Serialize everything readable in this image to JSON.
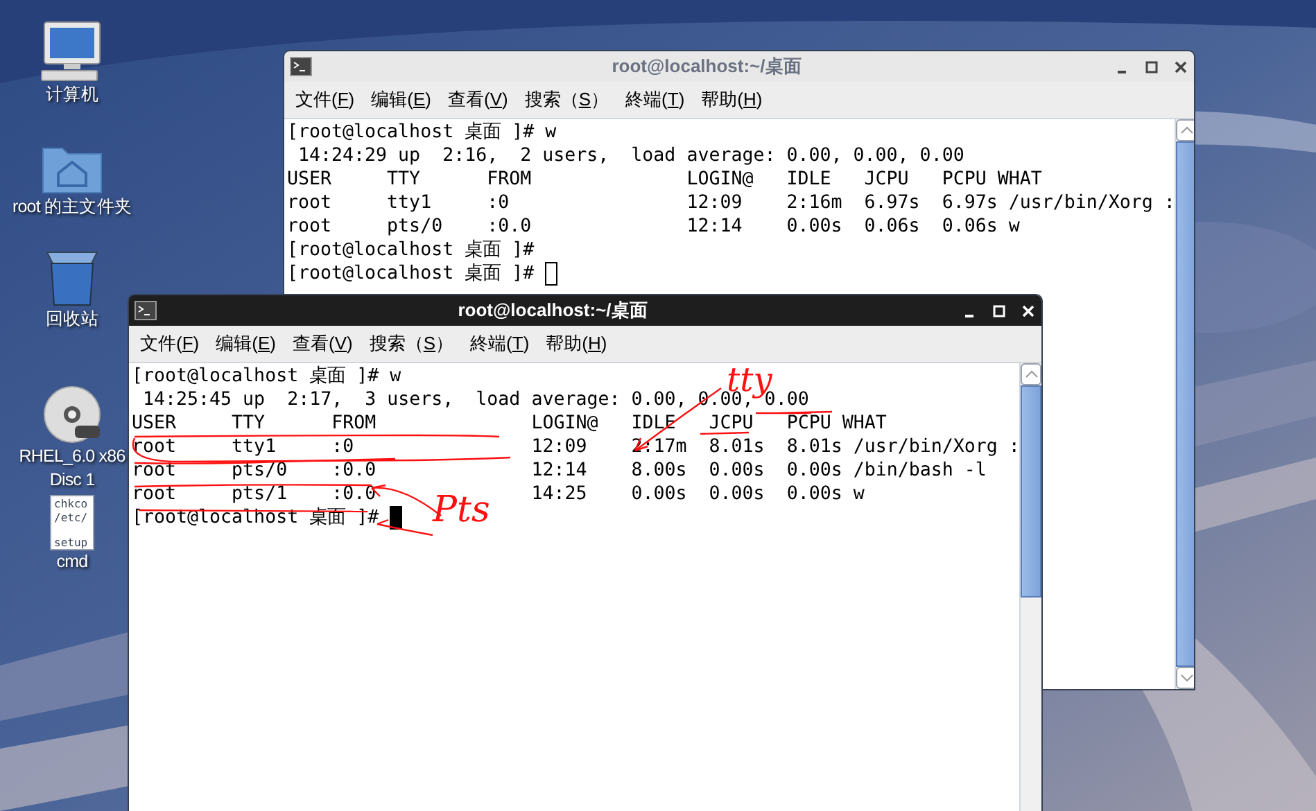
{
  "desktop_icons": [
    {
      "kind": "computer",
      "lines": [
        "计算机"
      ]
    },
    {
      "kind": "home",
      "lines": [
        "root 的主文件夹"
      ]
    },
    {
      "kind": "trash",
      "lines": [
        "回收站"
      ]
    },
    {
      "kind": "disc",
      "lines": [
        "RHEL_6.0 x86",
        "Disc 1"
      ]
    },
    {
      "kind": "file",
      "lines": [
        "cmd"
      ],
      "preview": [
        "chkco",
        "/etc/",
        "setup"
      ]
    }
  ],
  "windows": [
    {
      "title": "root@localhost:~/桌面",
      "active": false,
      "menu": [
        {
          "before": "文件(",
          "key": "F",
          "after": ")"
        },
        {
          "before": "编辑(",
          "key": "E",
          "after": ")"
        },
        {
          "before": "查看(",
          "key": "V",
          "after": ")"
        },
        {
          "before": "搜索（",
          "key": "S",
          "after": "）"
        },
        {
          "before": "終端(",
          "key": "T",
          "after": ")"
        },
        {
          "before": "帮助(",
          "key": "H",
          "after": ")"
        }
      ],
      "lines": [
        "[root@localhost 桌面 ]# w",
        " 14:24:29 up  2:16,  2 users,  load average: 0.00, 0.00, 0.00",
        "USER     TTY      FROM              LOGIN@   IDLE   JCPU   PCPU WHAT",
        "root     tty1     :0                12:09    2:16m  6.97s  6.97s /usr/bin/Xorg :",
        "root     pts/0    :0.0              12:14    0.00s  0.06s  0.06s w",
        "[root@localhost 桌面 ]#",
        "[root@localhost 桌面 ]#"
      ]
    },
    {
      "title": "root@localhost:~/桌面",
      "active": true,
      "menu": [
        {
          "before": "文件(",
          "key": "F",
          "after": ")"
        },
        {
          "before": "编辑(",
          "key": "E",
          "after": ")"
        },
        {
          "before": "查看(",
          "key": "V",
          "after": ")"
        },
        {
          "before": "搜索（",
          "key": "S",
          "after": "）"
        },
        {
          "before": "終端(",
          "key": "T",
          "after": ")"
        },
        {
          "before": "帮助(",
          "key": "H",
          "after": ")"
        }
      ],
      "lines": [
        "[root@localhost 桌面 ]# w",
        " 14:25:45 up  2:17,  3 users,  load average: 0.00, 0.00, 0.00",
        "USER     TTY      FROM              LOGIN@   IDLE   JCPU   PCPU WHAT",
        "root     tty1     :0                12:09    2:17m  8.01s  8.01s /usr/bin/Xorg :",
        "root     pts/0    :0.0              12:14    8.00s  0.00s  0.00s /bin/bash -l",
        "root     pts/1    :0.0              14:25    0.00s  0.00s  0.00s w",
        "[root@localhost 桌面 ]#"
      ]
    }
  ],
  "annotations": [
    {
      "text": "tty"
    },
    {
      "text": "Pts"
    }
  ]
}
